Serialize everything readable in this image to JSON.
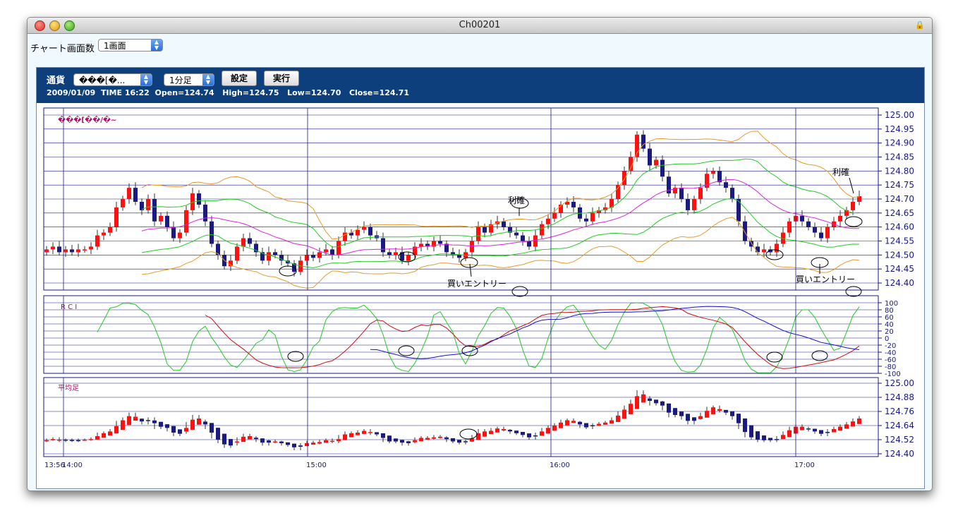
{
  "window": {
    "title": "Ch00201"
  },
  "top": {
    "screens_label": "チャート画面数",
    "screens_value": "1画面"
  },
  "toolbar": {
    "currency_label": "通貨",
    "currency_value": "���[�...",
    "timeframe_value": "1分足",
    "settings_label": "設定",
    "run_label": "実行",
    "info": {
      "date": "2009/01/09",
      "time": "TIME 16:22",
      "open": "Open=124.74",
      "high": "High=124.75",
      "low": "Low=124.70",
      "close": "Close=124.71"
    }
  },
  "chart_data": [
    {
      "type": "candlestick",
      "title": "���[��/�~",
      "y_ticks": [
        "125.00",
        "124.95",
        "124.90",
        "124.85",
        "124.80",
        "124.75",
        "124.70",
        "124.65",
        "124.60",
        "124.55",
        "124.50",
        "124.45",
        "124.40"
      ],
      "ylim": [
        124.4,
        125.0
      ],
      "close": [
        124.52,
        124.53,
        124.51,
        124.52,
        124.51,
        124.52,
        124.52,
        124.53,
        124.57,
        124.58,
        124.6,
        124.67,
        124.7,
        124.74,
        124.69,
        124.66,
        124.7,
        124.62,
        124.64,
        124.6,
        124.56,
        124.58,
        124.66,
        124.72,
        124.68,
        124.62,
        124.54,
        124.5,
        124.46,
        124.48,
        124.53,
        124.56,
        124.54,
        124.51,
        124.48,
        124.51,
        124.5,
        124.48,
        124.47,
        124.44,
        124.48,
        124.5,
        124.49,
        124.51,
        124.52,
        124.5,
        124.55,
        124.58,
        124.57,
        124.59,
        124.6,
        124.57,
        124.56,
        124.51,
        124.5,
        124.51,
        124.48,
        124.5,
        124.53,
        124.54,
        124.53,
        124.55,
        124.54,
        124.51,
        124.5,
        124.49,
        124.51,
        124.55,
        124.6,
        124.58,
        124.61,
        124.62,
        124.6,
        124.58,
        124.57,
        124.55,
        124.53,
        124.57,
        124.61,
        124.63,
        124.65,
        124.68,
        124.69,
        124.67,
        124.63,
        124.62,
        124.65,
        124.66,
        124.67,
        124.7,
        124.75,
        124.8,
        124.85,
        124.93,
        124.88,
        124.82,
        124.84,
        124.78,
        124.72,
        124.74,
        124.7,
        124.66,
        124.7,
        124.74,
        124.79,
        124.8,
        124.76,
        124.74,
        124.7,
        124.62,
        124.55,
        124.53,
        124.51,
        124.52,
        124.51,
        124.54,
        124.58,
        124.62,
        124.64,
        124.62,
        124.6,
        124.58,
        124.56,
        124.6,
        124.62,
        124.64,
        124.66,
        124.69,
        124.71
      ],
      "annotations": [
        "買いエントリー",
        "利確",
        "買いエントリー",
        "利確"
      ]
    },
    {
      "type": "line",
      "title": "R C I",
      "y_ticks": [
        "100",
        "80",
        "60",
        "40",
        "20",
        "0",
        "-20",
        "-40",
        "-60",
        "-80",
        "-100"
      ],
      "ylim": [
        -100,
        100
      ]
    },
    {
      "type": "candlestick",
      "title": "平均足",
      "y_ticks": [
        "125.00",
        "124.88",
        "124.76",
        "124.64",
        "124.52",
        "124.40"
      ],
      "ylim": [
        124.4,
        125.0
      ]
    }
  ],
  "x_ticks": [
    "13:56",
    "14:00",
    "15:00",
    "16:00",
    "17:00"
  ],
  "colors": {
    "up": "#ff1010",
    "down": "#1a1a80",
    "grid": "#1a1a80",
    "bb_outer": "#e89a2a",
    "bb_inner": "#22cc22",
    "ma": "#dd22dd",
    "rci_green": "#22cc22",
    "rci_red": "#cc1111",
    "rci_blue": "#1111cc",
    "toolbar": "#0d3f7d"
  }
}
